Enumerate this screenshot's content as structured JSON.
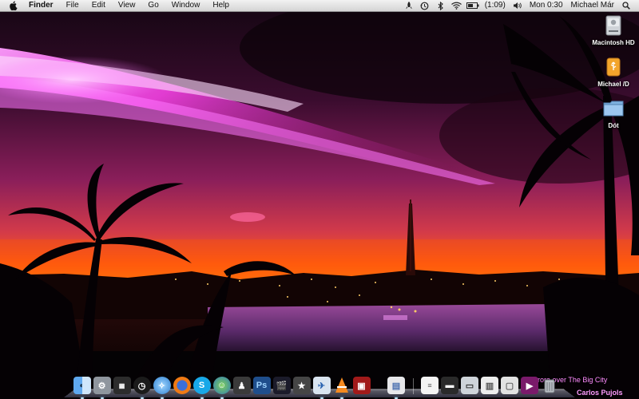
{
  "menubar": {
    "app_name": "Finder",
    "menus": [
      "File",
      "Edit",
      "View",
      "Go",
      "Window",
      "Help"
    ],
    "battery": "(1:09)",
    "clock": "Mon 0:30",
    "user": "Michael Már",
    "status_icons": [
      "rocket-icon",
      "time-machine-icon",
      "bluetooth-icon",
      "wifi-icon",
      "battery-icon",
      "volume-icon",
      "spotlight-icon"
    ]
  },
  "desktop": {
    "icons": [
      {
        "label": "Macintosh HD",
        "icon": "hard-drive-icon"
      },
      {
        "label": "Michael /D",
        "icon": "usb-drive-icon"
      },
      {
        "label": "Dót",
        "icon": "folder-icon"
      }
    ]
  },
  "wallpaper": {
    "credit_title": "Aurora over The Big City",
    "credit_author": "Carlos Pujols"
  },
  "dock": {
    "apps": [
      "finder-icon",
      "system-preferences-icon",
      "calculator-icon",
      "clock-icon",
      "safari-icon",
      "firefox-icon",
      "skype-icon",
      "messenger-icon",
      "app-icon",
      "photoshop-icon",
      "final-cut-icon",
      "imovie-icon",
      "mail-icon",
      "vlc-icon",
      "photo-booth-icon",
      "preview-icon",
      "textedit-icon",
      "downloads-icon",
      "applications-icon",
      "documents-icon",
      "screenshot-icon",
      "movies-icon",
      "trash-icon"
    ]
  },
  "colors": {
    "sky_top": "#1a0616",
    "aurora": "#ff55ff",
    "horizon": "#ff5a00",
    "water": "#7a3a8a"
  }
}
